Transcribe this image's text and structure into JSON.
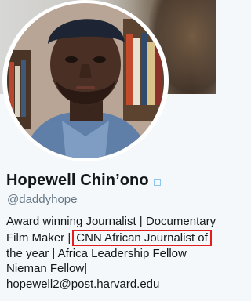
{
  "profile": {
    "display_name": "Hopewell Chin’ono",
    "handle": "@daddyhope",
    "bio": {
      "line1": "Award winning Journalist | Documentary",
      "line2_prefix": "Film Maker |",
      "line2_highlight": "CNN African Journalist of",
      "line3": "the year | Africa Leadership Fellow",
      "line4": "Nieman Fellow|",
      "line5": "hopewell2@post.harvard.edu"
    }
  },
  "colors": {
    "highlight_border": "#e11d1d",
    "verified_badge": "#8fc6ef",
    "handle_text": "#657786"
  },
  "icons": {
    "verified": "verified-badge-icon"
  }
}
